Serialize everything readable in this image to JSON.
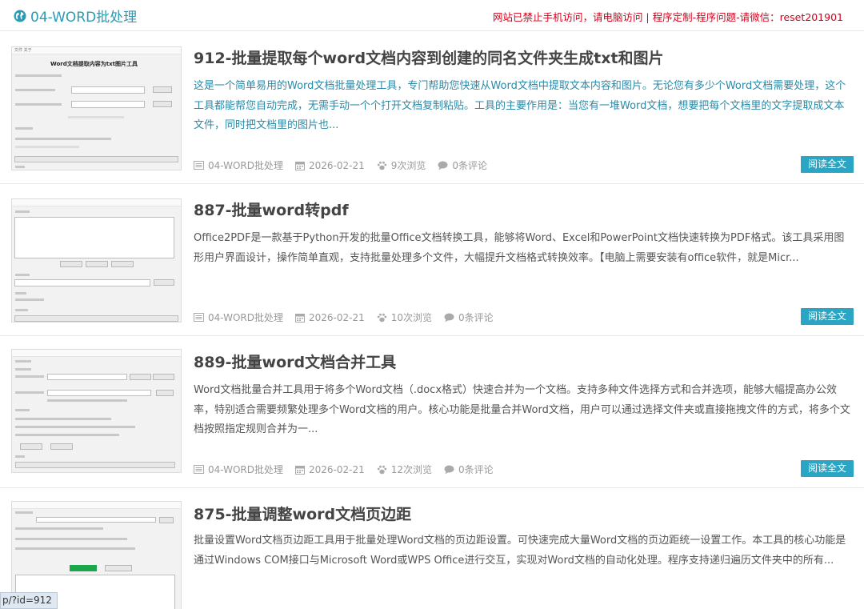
{
  "header": {
    "category": "04-WORD批处理",
    "notice": "网站已禁止手机访问，请电脑访问 | 程序定制-程序问题-请微信：reset201901",
    "colors": {
      "accent": "#2a9bb5",
      "notice": "#d0021b",
      "button": "#2aa5c4"
    }
  },
  "posts": [
    {
      "title": "912-批量提取每个word文档内容到创建的同名文件夹生成txt和图片",
      "excerpt": "这是一个简单易用的Word文档批量处理工具，专门帮助您快速从Word文档中提取文本内容和图片。无论您有多少个Word文档需要处理，这个工具都能帮您自动完成，无需手动一个个打开文档复制粘贴。工具的主要作用是：当您有一堆Word文档，想要把每个文档里的文字提取成文本文件，同时把文档里的图片也...",
      "category": "04-WORD批处理",
      "date": "2026-02-21",
      "views": "9次浏览",
      "comments": "0条评论",
      "read_more": "阅读全文",
      "thumb_heading": "Word文档提取内容为txt图片工具"
    },
    {
      "title": "887-批量word转pdf",
      "excerpt": "Office2PDF是一款基于Python开发的批量Office文档转换工具，能够将Word、Excel和PowerPoint文档快速转换为PDF格式。该工具采用图形用户界面设计，操作简单直观，支持批量处理多个文件，大幅提升文档格式转换效率。【电脑上需要安装有office软件，就是Micr...",
      "category": "04-WORD批处理",
      "date": "2026-02-21",
      "views": "10次浏览",
      "comments": "0条评论",
      "read_more": "阅读全文"
    },
    {
      "title": "889-批量word文档合并工具",
      "excerpt": "Word文档批量合并工具用于将多个Word文档（.docx格式）快速合并为一个文档。支持多种文件选择方式和合并选项，能够大幅提高办公效率，特别适合需要频繁处理多个Word文档的用户。核心功能是批量合并Word文档，用户可以通过选择文件夹或直接拖拽文件的方式，将多个文档按照指定规则合并为一...",
      "category": "04-WORD批处理",
      "date": "2026-02-21",
      "views": "12次浏览",
      "comments": "0条评论",
      "read_more": "阅读全文"
    },
    {
      "title": "875-批量调整word文档页边距",
      "excerpt": "批量设置Word文档页边距工具用于批量处理Word文档的页边距设置。可快速完成大量Word文档的页边距统一设置工作。本工具的核心功能是通过Windows COM接口与Microsoft Word或WPS Office进行交互，实现对Word文档的自动化处理。程序支持递归遍历文件夹中的所有..."
    }
  ],
  "status_url": "p/?id=912"
}
